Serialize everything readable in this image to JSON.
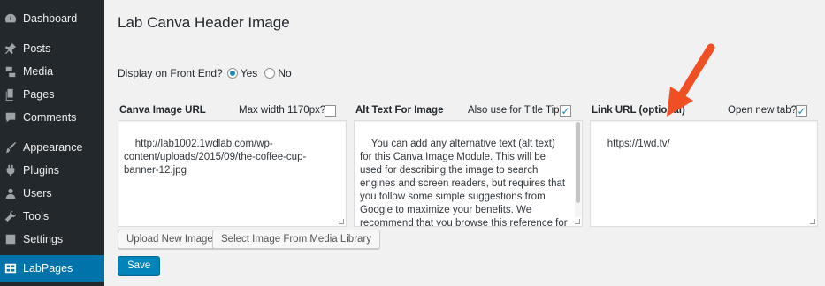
{
  "sidebar": {
    "items": [
      {
        "label": "Dashboard",
        "icon": "dashboard-icon"
      },
      {
        "label": "Posts",
        "icon": "pin-icon"
      },
      {
        "label": "Media",
        "icon": "media-icon"
      },
      {
        "label": "Pages",
        "icon": "pages-icon"
      },
      {
        "label": "Comments",
        "icon": "comments-icon"
      },
      {
        "label": "Appearance",
        "icon": "brush-icon"
      },
      {
        "label": "Plugins",
        "icon": "plugin-icon"
      },
      {
        "label": "Users",
        "icon": "users-icon"
      },
      {
        "label": "Tools",
        "icon": "wrench-icon"
      },
      {
        "label": "Settings",
        "icon": "settings-icon"
      },
      {
        "label": "LabPages",
        "icon": "grid-icon",
        "active": true
      }
    ]
  },
  "page": {
    "title": "Lab Canva Header Image",
    "display_label": "Display on Front End?",
    "display_yes": "Yes",
    "display_no": "No",
    "display_value": "Yes"
  },
  "canva": {
    "label": "Canva Image URL",
    "maxwidth_label": "Max width 1170px?",
    "maxwidth_checked": false,
    "value": "http://lab1002.1wdlab.com/wp-content/uploads/2015/09/the-coffee-cup-banner-12.jpg"
  },
  "alt": {
    "label": "Alt Text For Image",
    "title_tip_label": "Also use for Title Tip?",
    "title_tip_checked": true,
    "value": "You can add any alternative text (alt text) for this Canva Image Module. This will be used for describing the image to search engines and screen readers, but requires that you follow some simple suggestions from Google to maximize your benefits. We recommend that you browse this reference for some simple tips: https://support.google.com/webmasters/answe"
  },
  "link": {
    "label": "Link URL (optional)",
    "newtab_label": "Open new tab?",
    "newtab_checked": true,
    "value": "https://1wd.tv/"
  },
  "buttons": {
    "upload": "Upload New Image",
    "media": "Select Image From Media Library",
    "save": "Save"
  },
  "colors": {
    "sidebar_bg": "#23282d",
    "active_bg": "#0073aa",
    "primary": "#0085ba",
    "annotation_arrow": "#f04e23"
  }
}
